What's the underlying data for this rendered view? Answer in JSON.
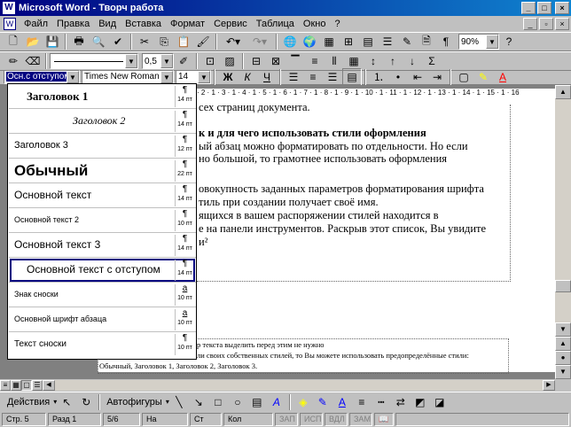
{
  "window": {
    "title": "Microsoft Word - Творч работа"
  },
  "menu": [
    "Файл",
    "Правка",
    "Вид",
    "Вставка",
    "Формат",
    "Сервис",
    "Таблица",
    "Окно",
    "?"
  ],
  "standard_toolbar": {
    "zoom": "90%"
  },
  "formatting_toolbar": {
    "style_value": "Осн.с отступом",
    "font_value": "Times New Roman",
    "size_value": "14",
    "bold": "Ж",
    "italic": "К",
    "underline": "Ч"
  },
  "drawing_toolbar": {
    "linewidth_value": "0,5"
  },
  "ruler_text": "· 2 · 1 · 3 · 1 · 4 · 1 · 5 · 1 · 6 · 1 · 7 · 1 · 8 · 1 · 9 · 1 · 10 · 1 · 11 · 1 · 12 · 1 · 13 · 1 · 14 · 1 · 15 · 1 · 16",
  "style_list": [
    {
      "name": "Заголовок 1",
      "size": "14 пт",
      "mark": "¶"
    },
    {
      "name": "Заголовок 2",
      "size": "14 пт",
      "mark": "¶"
    },
    {
      "name": "Заголовок 3",
      "size": "12 пт",
      "mark": "¶"
    },
    {
      "name": "Обычный",
      "size": "22 пт",
      "mark": "¶"
    },
    {
      "name": "Основной текст",
      "size": "14 пт",
      "mark": "¶"
    },
    {
      "name": "Основной текст 2",
      "size": "10 пт",
      "mark": "¶"
    },
    {
      "name": "Основной текст 3",
      "size": "14 пт",
      "mark": "¶"
    },
    {
      "name": "Основной текст с отступом",
      "size": "14 пт",
      "mark": "¶"
    },
    {
      "name": "Знак сноски",
      "size": "10 пт",
      "mark": "a"
    },
    {
      "name": "Основной шрифт абзаца",
      "size": "10 пт",
      "mark": "a"
    },
    {
      "name": "Текст сноски",
      "size": "10 пт",
      "mark": "¶"
    }
  ],
  "document": {
    "lines": [
      "сех страниц документа.",
      "к и для чего использовать стили оформления",
      "ый абзац можно форматировать по отдельности. Но если",
      "но большой, то грамотнее использовать оформления",
      "овокупность заданных параметров форматирования шрифта",
      "тиль при создании получает своё имя.",
      "ящихся в вашем распоряжении стилей находится в",
      "е на панели инструментов. Раскрыв этот список, Вы увидите",
      "и²"
    ],
    "footnotes": [
      "р текста выделить перед этим не нужно",
      "ли своих собственных стилей, то Вы можете использовать предопределённые стили:",
      "Обычный, Заголовок 1, Заголовок 2, Заголовок 3."
    ]
  },
  "drawing": {
    "actions": "Действия",
    "autoshapes": "Автофигуры"
  },
  "status": {
    "page": "Стр. 5",
    "section": "Разд 1",
    "pages": "5/6",
    "at": "На",
    "line": "Ст",
    "col": "Кол",
    "rec": "ЗАП",
    "trk": "ИСПР",
    "ext": "ВДЛ",
    "ovr": "ЗАМ"
  }
}
